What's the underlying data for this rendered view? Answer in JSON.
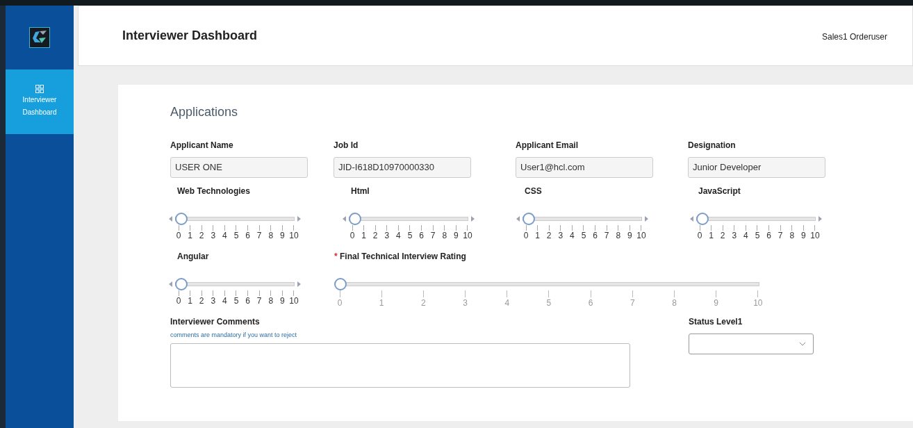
{
  "sidebar": {
    "items": [
      {
        "label": "Interviewer Dashboard",
        "selected": true
      }
    ]
  },
  "header": {
    "title": "Interviewer Dashboard",
    "user": "Sales1 Orderuser"
  },
  "card": {
    "title": "Applications",
    "fields": [
      {
        "label": "Applicant Name",
        "value": "USER ONE"
      },
      {
        "label": "Job Id",
        "value": "JID-I618D10970000330"
      },
      {
        "label": "Applicant Email",
        "value": "User1@hcl.com"
      },
      {
        "label": "Designation",
        "value": "Junior Developer"
      }
    ],
    "skills": [
      {
        "label": "Web Technologies",
        "level": 0,
        "ticks": [
          "0",
          "1",
          "2",
          "3",
          "4",
          "5",
          "6",
          "7",
          "8",
          "9",
          "10"
        ]
      },
      {
        "label": "Html",
        "level": 0,
        "ticks": [
          "0",
          "1",
          "2",
          "3",
          "4",
          "5",
          "6",
          "7",
          "8",
          "9",
          "10"
        ]
      },
      {
        "label": "CSS",
        "level": 0,
        "ticks": [
          "0",
          "1",
          "2",
          "3",
          "4",
          "5",
          "6",
          "7",
          "8",
          "9",
          "10"
        ]
      },
      {
        "label": "JavaScript",
        "level": 0,
        "ticks": [
          "0",
          "1",
          "2",
          "3",
          "4",
          "5",
          "6",
          "7",
          "8",
          "9",
          "10"
        ]
      },
      {
        "label": "Angular",
        "level": 0,
        "ticks": [
          "0",
          "1",
          "2",
          "3",
          "4",
          "5",
          "6",
          "7",
          "8",
          "9",
          "10"
        ]
      }
    ],
    "final_rating": {
      "required_mark": "*",
      "label": "Final Technical Interview Rating",
      "level": 0,
      "ticks": [
        "0",
        "1",
        "2",
        "3",
        "4",
        "5",
        "6",
        "7",
        "8",
        "9",
        "10"
      ]
    },
    "comments": {
      "label": "Interviewer Comments",
      "hint": "comments are mandatory if you want to reject"
    },
    "status": {
      "label": "Status Level1"
    }
  }
}
